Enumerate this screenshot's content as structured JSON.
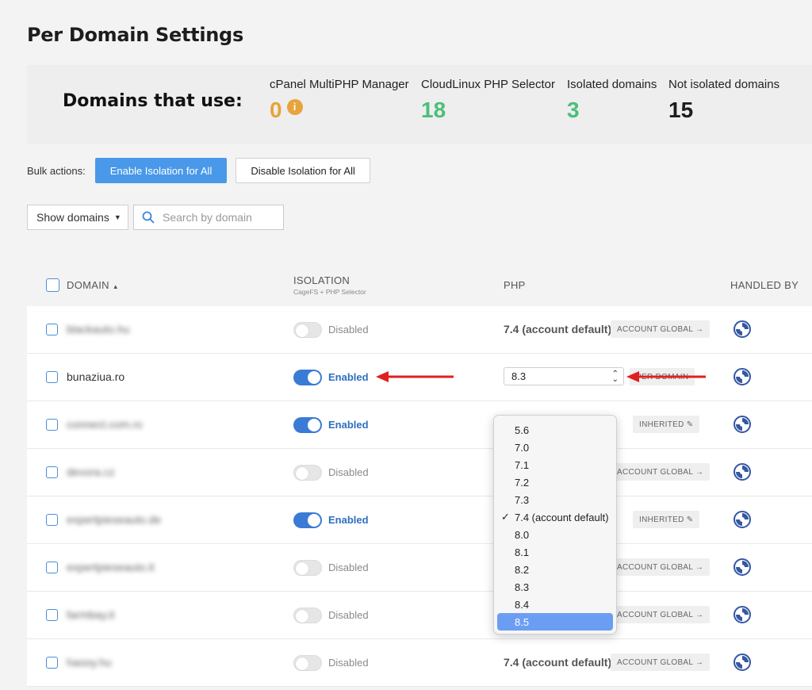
{
  "page_title": "Per Domain Settings",
  "stats": {
    "label": "Domains that use:",
    "items": [
      {
        "label": "cPanel MultiPHP Manager",
        "value": "0",
        "color": "#e8a33b",
        "info": "i"
      },
      {
        "label": "CloudLinux PHP Selector",
        "value": "18",
        "color": "#4bbf7a"
      },
      {
        "label": "Isolated domains",
        "value": "3",
        "color": "#4bbf7a"
      },
      {
        "label": "Not isolated domains",
        "value": "15",
        "color": "#1d1d1f"
      }
    ]
  },
  "bulk": {
    "label": "Bulk actions:",
    "enable": "Enable Isolation for All",
    "disable": "Disable Isolation for All"
  },
  "filters": {
    "show_domains": "Show domains",
    "search_placeholder": "Search by domain"
  },
  "table": {
    "headers": {
      "domain": "DOMAIN",
      "isolation": "ISOLATION",
      "isolation_sub": "CageFS + PHP Selector",
      "php": "PHP",
      "handled_by": "HANDLED BY"
    },
    "rows": [
      {
        "domain": "blackauto.hu",
        "blurred": true,
        "isolation": "Disabled",
        "enabled": false,
        "php": "7.4 (account default)",
        "badge": "ACCOUNT GLOBAL →"
      },
      {
        "domain": "bunaziua.ro",
        "blurred": false,
        "isolation": "Enabled",
        "enabled": true,
        "php": "8.3",
        "badge": "PER DOMAIN"
      },
      {
        "domain": "connect.com.ro",
        "blurred": true,
        "isolation": "Enabled",
        "enabled": true,
        "php": "",
        "badge": "INHERITED"
      },
      {
        "domain": "devora.cz",
        "blurred": true,
        "isolation": "Disabled",
        "enabled": false,
        "php": "",
        "badge": "ACCOUNT GLOBAL →"
      },
      {
        "domain": "expertpieseauto.de",
        "blurred": true,
        "isolation": "Enabled",
        "enabled": true,
        "php": "",
        "badge": "INHERITED"
      },
      {
        "domain": "expertpieseauto.it",
        "blurred": true,
        "isolation": "Disabled",
        "enabled": false,
        "php": "",
        "badge": "ACCOUNT GLOBAL →"
      },
      {
        "domain": "farmbay.it",
        "blurred": true,
        "isolation": "Disabled",
        "enabled": false,
        "php": "",
        "badge": "ACCOUNT GLOBAL →"
      },
      {
        "domain": "haooy.hu",
        "blurred": true,
        "isolation": "Disabled",
        "enabled": false,
        "php": "7.4 (account default)",
        "badge": "ACCOUNT GLOBAL →"
      }
    ]
  },
  "dropdown": {
    "options": [
      "5.6",
      "7.0",
      "7.1",
      "7.2",
      "7.3",
      "7.4 (account default)",
      "8.0",
      "8.1",
      "8.2",
      "8.3",
      "8.4",
      "8.5"
    ],
    "checked": "7.4 (account default)",
    "highlighted": "8.5",
    "check_mark": "✓"
  },
  "colors": {
    "primary": "#4a98e9",
    "toggle_on": "#3a7bd5",
    "arrow": "#e02020",
    "highlight": "#6b9ef3"
  }
}
